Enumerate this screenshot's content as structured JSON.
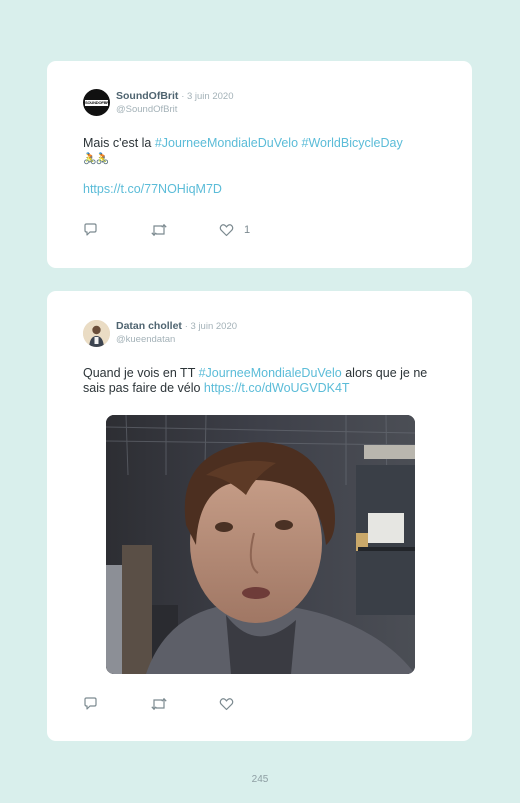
{
  "tweets": [
    {
      "author_name": "SoundOfBrit",
      "date": "· 3 juin 2020",
      "handle": "@SoundOfBrit",
      "avatar_text": "SOUNDOFBRIT",
      "text_plain": "Mais c'est la ",
      "hashtags": [
        "#JourneeMondialeDuVelo",
        "#WorldBicycleDay"
      ],
      "emoji": "🚴🚴",
      "link": "https://t.co/77NOHiqM7D",
      "like_count": "1",
      "icons": [
        "reply-icon",
        "retweet-icon",
        "like-icon"
      ]
    },
    {
      "author_name": "Datan chollet",
      "date": "· 3 juin 2020",
      "handle": "@kueendatan",
      "text_before": "Quand je vois en TT ",
      "hashtag": "#JourneeMondialeDuVelo",
      "text_after": " alors que je ne sais pas faire de vélo ",
      "link": "https://t.co/dWoUGVDK4T",
      "icons": [
        "reply-icon",
        "retweet-icon",
        "like-icon"
      ]
    }
  ],
  "page_number": "245",
  "colors": {
    "background": "#d9efec",
    "link": "#5bbcd8",
    "name": "#4f6470",
    "muted": "#a4b2b8"
  }
}
